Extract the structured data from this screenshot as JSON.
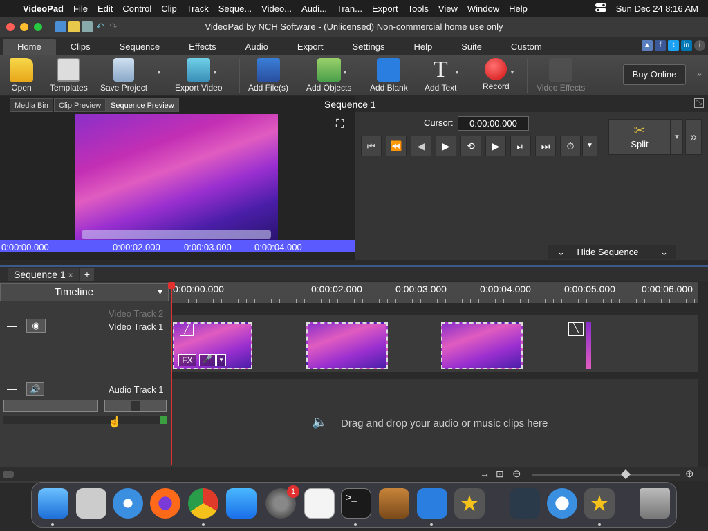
{
  "menubar": {
    "apple_glyph": "",
    "app_name": "VideoPad",
    "items": [
      "File",
      "Edit",
      "Control",
      "Clip",
      "Track",
      "Seque...",
      "Video...",
      "Audi...",
      "Tran...",
      "Export",
      "Tools",
      "View",
      "Window",
      "Help"
    ],
    "datetime": "Sun Dec 24  8:16 AM"
  },
  "window": {
    "title": "VideoPad by NCH Software - (Unlicensed) Non-commercial home use only"
  },
  "tabs": [
    "Home",
    "Clips",
    "Sequence",
    "Effects",
    "Audio",
    "Export",
    "Settings",
    "Help",
    "Suite",
    "Custom"
  ],
  "toolbar": {
    "open": "Open",
    "templates": "Templates",
    "save_project": "Save Project",
    "export_video": "Export Video",
    "add_files": "Add File(s)",
    "add_objects": "Add Objects",
    "add_blank": "Add Blank",
    "add_text": "Add Text",
    "record": "Record",
    "video_effects": "Video Effects",
    "buy_online": "Buy Online",
    "add_text_glyph": "T"
  },
  "preview": {
    "tabs": [
      "Media Bin",
      "Clip Preview",
      "Sequence Preview"
    ],
    "title": "Sequence 1",
    "times": [
      "0:00:00.000",
      "0:00:02.000",
      "0:00:03.000",
      "0:00:04.000"
    ]
  },
  "transport": {
    "cursor_label": "Cursor:",
    "cursor_value": "0:00:00.000",
    "split_label": "Split",
    "hide_sequence": "Hide Sequence"
  },
  "sequence": {
    "tab_label": "Sequence 1",
    "close_glyph": "×",
    "add_glyph": "+",
    "view_select": "Timeline",
    "ruler_labels": [
      "0:00:00.000",
      "0:00:02.000",
      "0:00:03.000",
      "0:00:04.000",
      "0:00:05.000",
      "0:00:06.000"
    ],
    "video_track_2": "Video Track 2",
    "video_track_1": "Video Track 1",
    "audio_track_1": "Audio Track 1",
    "drop_hint": "Drag and drop your audio or music clips here",
    "fx_label": "FX",
    "collapse_glyph": "—"
  },
  "dock": {
    "terminal_prompt": ">_",
    "notification_badge": "1"
  },
  "colors": {
    "accent": "#5a5aff",
    "playhead": "#e03030",
    "record": "#e02020"
  }
}
